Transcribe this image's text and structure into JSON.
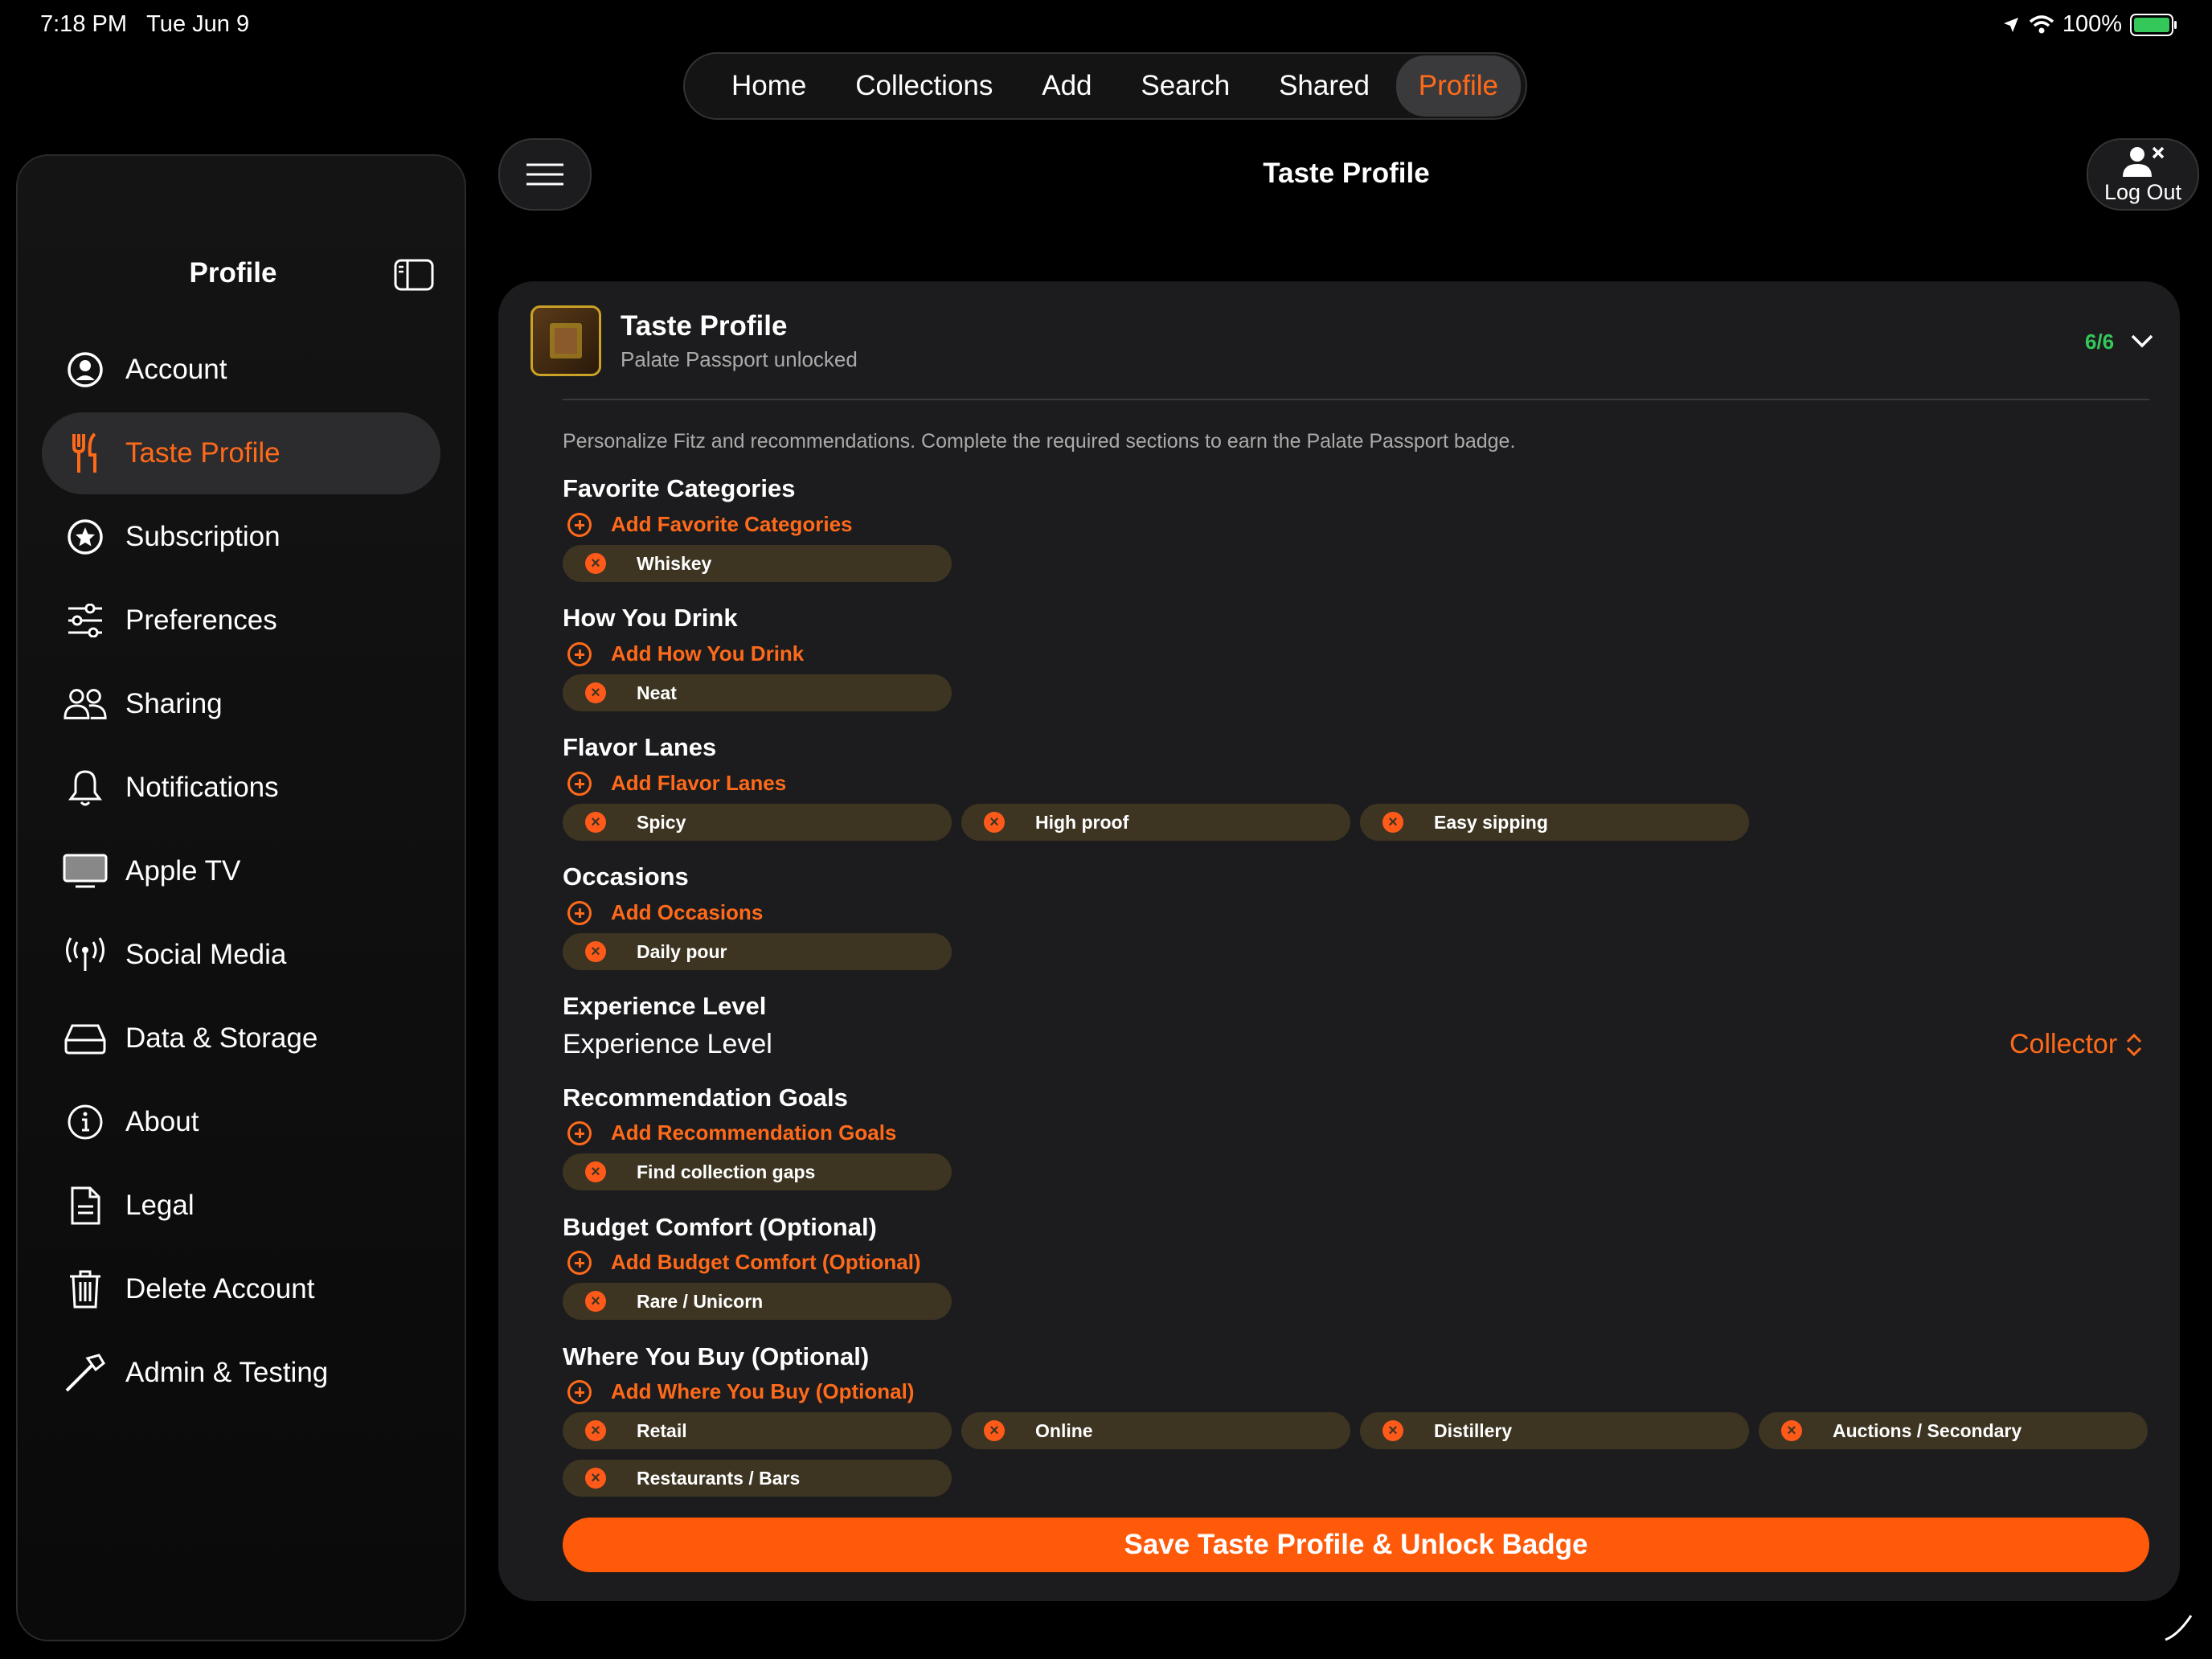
{
  "status": {
    "time": "7:18 PM",
    "date": "Tue Jun 9",
    "battery": "100%"
  },
  "tabs": [
    "Home",
    "Collections",
    "Add",
    "Search",
    "Shared",
    "Profile"
  ],
  "active_tab": "Profile",
  "sidebar": {
    "title": "Profile",
    "items": [
      {
        "label": "Account",
        "icon": "person-circle-icon"
      },
      {
        "label": "Taste Profile",
        "icon": "fork-knife-icon",
        "active": true
      },
      {
        "label": "Subscription",
        "icon": "star-circle-icon"
      },
      {
        "label": "Preferences",
        "icon": "sliders-icon"
      },
      {
        "label": "Sharing",
        "icon": "people-icon"
      },
      {
        "label": "Notifications",
        "icon": "bell-icon"
      },
      {
        "label": "Apple TV",
        "icon": "tv-icon"
      },
      {
        "label": "Social Media",
        "icon": "broadcast-icon"
      },
      {
        "label": "Data & Storage",
        "icon": "drive-icon"
      },
      {
        "label": "About",
        "icon": "info-icon"
      },
      {
        "label": "Legal",
        "icon": "document-icon"
      },
      {
        "label": "Delete Account",
        "icon": "trash-icon"
      },
      {
        "label": "Admin & Testing",
        "icon": "hammer-icon"
      }
    ]
  },
  "header": {
    "title": "Taste Profile",
    "logout": "Log Out"
  },
  "card": {
    "title": "Taste Profile",
    "subtitle": "Palate Passport unlocked",
    "progress": "6/6",
    "intro": "Personalize Fitz and recommendations. Complete the required sections to earn the Palate Passport badge.",
    "sections": [
      {
        "heading": "Favorite Categories",
        "add": "Add Favorite Categories",
        "chips": [
          "Whiskey"
        ]
      },
      {
        "heading": "How You Drink",
        "add": "Add How You Drink",
        "chips": [
          "Neat"
        ]
      },
      {
        "heading": "Flavor Lanes",
        "add": "Add Flavor Lanes",
        "chips": [
          "Spicy",
          "High proof",
          "Easy sipping"
        ]
      },
      {
        "heading": "Occasions",
        "add": "Add Occasions",
        "chips": [
          "Daily pour"
        ]
      }
    ],
    "experience": {
      "heading": "Experience Level",
      "label": "Experience Level",
      "value": "Collector"
    },
    "sections2": [
      {
        "heading": "Recommendation Goals",
        "add": "Add Recommendation Goals",
        "chips": [
          "Find collection gaps"
        ]
      },
      {
        "heading": "Budget Comfort (Optional)",
        "add": "Add Budget Comfort (Optional)",
        "chips": [
          "Rare / Unicorn"
        ]
      },
      {
        "heading": "Where You Buy (Optional)",
        "add": "Add Where You Buy (Optional)",
        "chips": [
          "Retail",
          "Online",
          "Distillery",
          "Auctions / Secondary",
          "Restaurants / Bars"
        ]
      }
    ],
    "save": "Save Taste Profile & Unlock Badge"
  },
  "colors": {
    "accent": "#ff6a1a",
    "success": "#34c759",
    "chip_bg": "#3d3522"
  }
}
